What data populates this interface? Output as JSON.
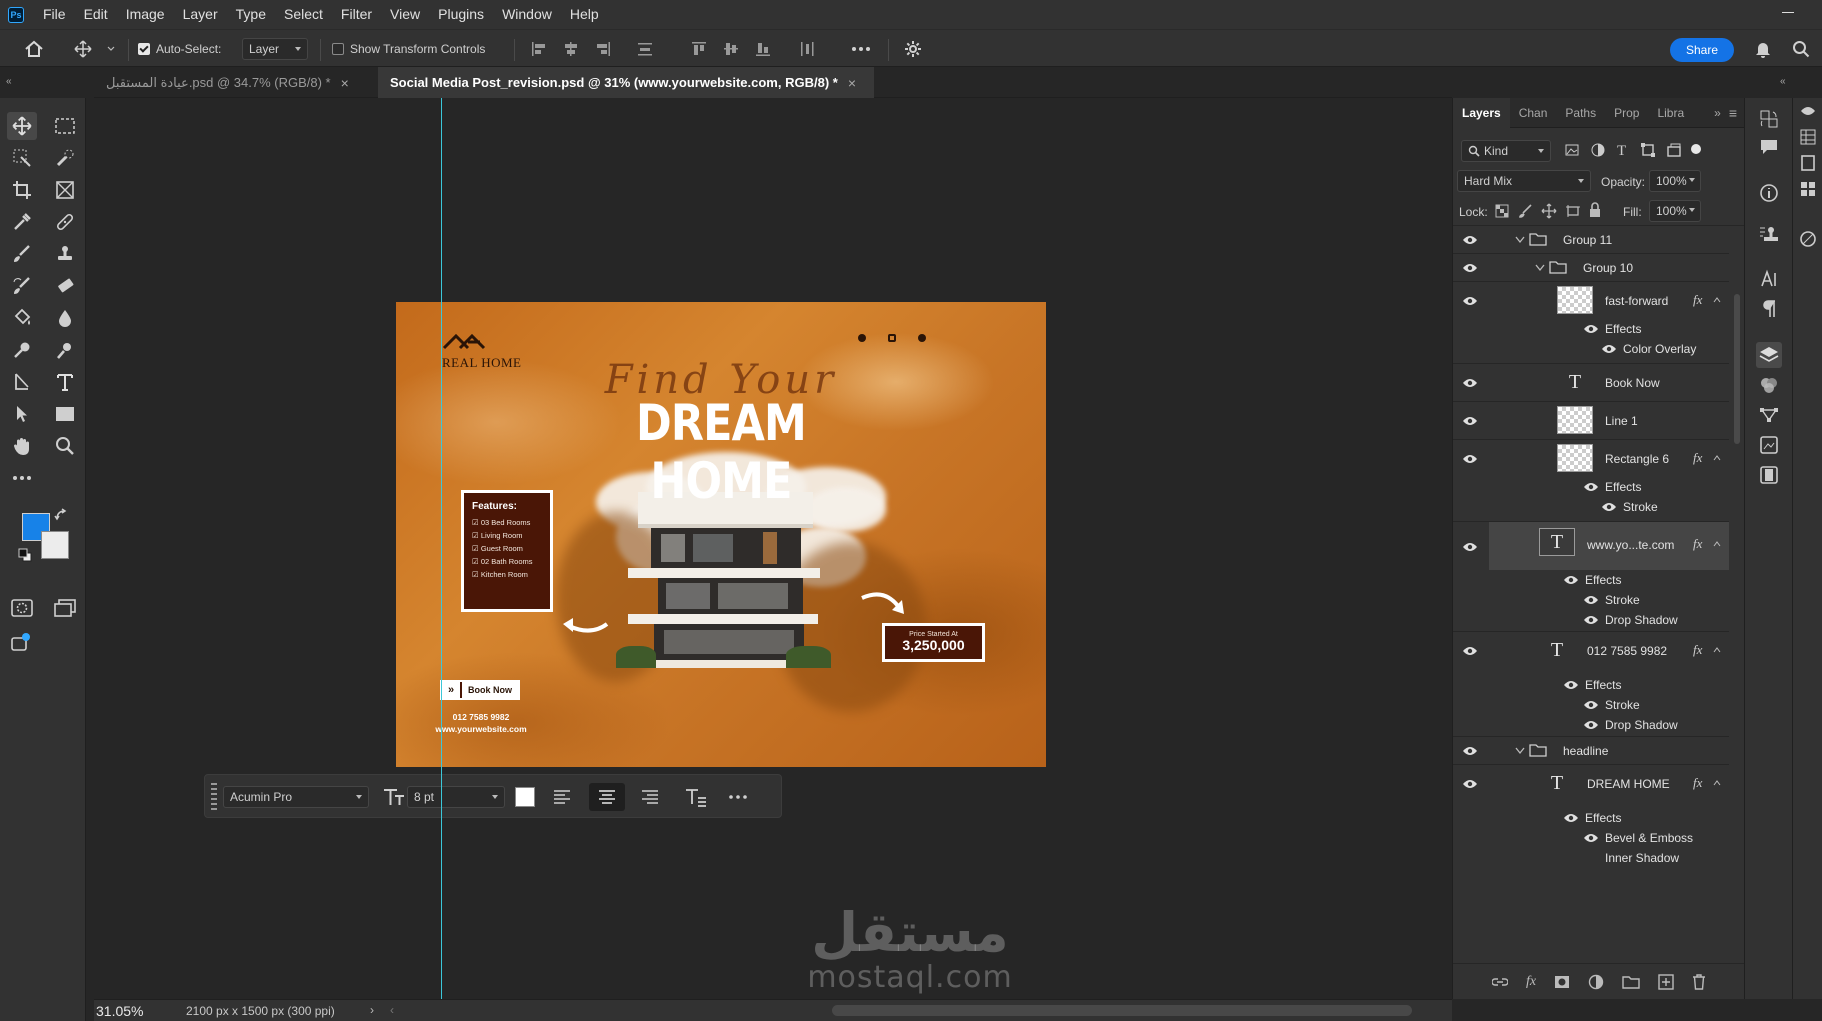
{
  "app": {
    "logo": "Ps"
  },
  "menubar": {
    "items": [
      "File",
      "Edit",
      "Image",
      "Layer",
      "Type",
      "Select",
      "Filter",
      "View",
      "Plugins",
      "Window",
      "Help"
    ]
  },
  "options_bar": {
    "auto_select_label": "Auto-Select:",
    "auto_select_checked": true,
    "target_value": "Layer",
    "transform_label": "Show Transform Controls",
    "transform_checked": false,
    "share_label": "Share"
  },
  "tabs": [
    {
      "label": "عيادة المستقبل.psd @ 34.7% (RGB/8) *",
      "active": false
    },
    {
      "label": "Social Media Post_revision.psd @ 31% (www.yourwebsite.com, RGB/8) *",
      "active": true
    }
  ],
  "artwork": {
    "logo_text": "REAL HOME",
    "script_title": "Find Your",
    "headline": "DREAM HOME",
    "features_title": "Features:",
    "features": [
      "03 Bed Rooms",
      "Living Room",
      "Guest Room",
      "02 Bath Rooms",
      "Kitchen Room"
    ],
    "price_label": "Price Started At",
    "price_value": "3,250,000",
    "book_now": "Book Now",
    "phone": "012 7585 9982",
    "website": "www.yourwebsite.com"
  },
  "text_toolbar": {
    "font_family": "Acumin Pro",
    "font_size": "8 pt"
  },
  "status": {
    "zoom": "31.05%",
    "doc_info": "2100 px x 1500 px (300 ppi)"
  },
  "layers_panel": {
    "tabs": [
      "Layers",
      "Chan",
      "Paths",
      "Prop",
      "Libra"
    ],
    "filter_kind": "Kind",
    "blend_mode": "Hard Mix",
    "opacity_label": "Opacity:",
    "opacity_value": "100%",
    "lock_label": "Lock:",
    "fill_label": "Fill:",
    "fill_value": "100%",
    "rows": {
      "group11": "Group 11",
      "group10": "Group 10",
      "fastforward": "fast-forward",
      "effects": "Effects",
      "color_overlay": "Color Overlay",
      "book_now": "Book Now",
      "line1": "Line 1",
      "rect6": "Rectangle 6",
      "stroke": "Stroke",
      "website": "www.yo...te.com",
      "drop_shadow": "Drop Shadow",
      "phone": "012 7585 9982",
      "headline_group": "headline",
      "dream_home": "DREAM HOME",
      "bevel": "Bevel & Emboss",
      "inner_shadow": "Inner Shadow",
      "fx": "fx"
    }
  },
  "watermark": {
    "arabic": "مستقل",
    "latin": "mostaql.com"
  }
}
